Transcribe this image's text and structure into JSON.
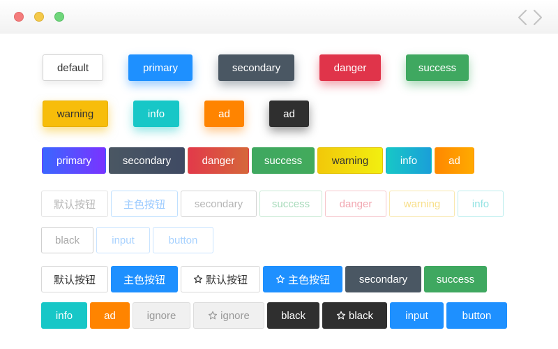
{
  "window": {
    "controls": [
      "close-dot",
      "minimize-dot",
      "maximize-dot"
    ],
    "code_icon": "code-angle-brackets-icon"
  },
  "colors": {
    "primary": "#1e90ff",
    "secondary": "#4a5763",
    "danger": "#e0344a",
    "success": "#3fa860",
    "warning": "#f7bd0a",
    "info": "#17c7c7",
    "ad": "#ff8400",
    "black": "#2f2f2f"
  },
  "shadow_row": {
    "default": "default",
    "primary": "primary",
    "secondary": "secondary",
    "danger": "danger",
    "success": "success",
    "warning": "warning",
    "info": "info",
    "ad": "ad"
  },
  "gradient_row": {
    "primary": "primary",
    "secondary": "secondary",
    "danger": "danger",
    "success": "success",
    "warning": "warning",
    "info": "info",
    "ad": "ad"
  },
  "outline_row": {
    "default": "默认按钮",
    "primary": "主色按钮",
    "secondary": "secondary",
    "success": "success",
    "danger": "danger",
    "warning": "warning",
    "info": "info",
    "black": "black",
    "input": "input",
    "button": "button"
  },
  "solid_row": {
    "default": "默认按钮",
    "primary": "主色按钮",
    "default_star": "默认按钮",
    "primary_star": "主色按钮",
    "secondary": "secondary",
    "success": "success",
    "info": "info",
    "ad": "ad",
    "ignore": "ignore",
    "ignore_star": "ignore",
    "black": "black",
    "black_star": "black",
    "input": "input",
    "button": "button"
  },
  "icons": {
    "star": "star-outline-icon"
  }
}
